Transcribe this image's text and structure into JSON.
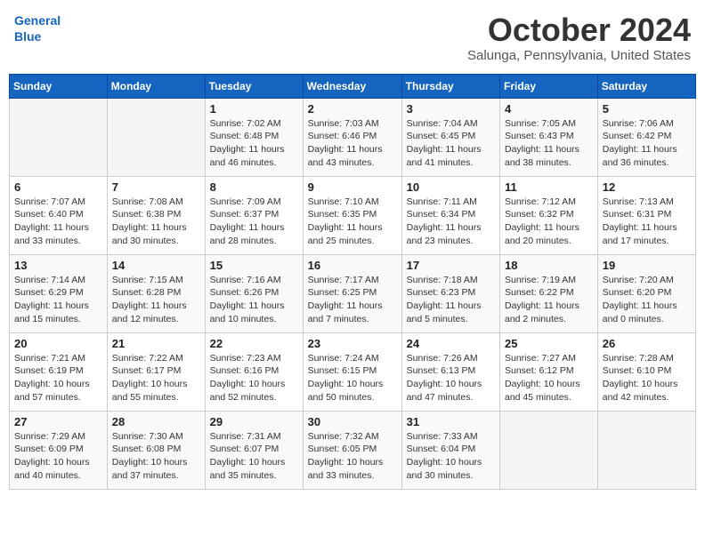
{
  "header": {
    "logo_line1": "General",
    "logo_line2": "Blue",
    "month": "October 2024",
    "location": "Salunga, Pennsylvania, United States"
  },
  "days_of_week": [
    "Sunday",
    "Monday",
    "Tuesday",
    "Wednesday",
    "Thursday",
    "Friday",
    "Saturday"
  ],
  "weeks": [
    [
      {
        "day": "",
        "info": ""
      },
      {
        "day": "",
        "info": ""
      },
      {
        "day": "1",
        "info": "Sunrise: 7:02 AM\nSunset: 6:48 PM\nDaylight: 11 hours and 46 minutes."
      },
      {
        "day": "2",
        "info": "Sunrise: 7:03 AM\nSunset: 6:46 PM\nDaylight: 11 hours and 43 minutes."
      },
      {
        "day": "3",
        "info": "Sunrise: 7:04 AM\nSunset: 6:45 PM\nDaylight: 11 hours and 41 minutes."
      },
      {
        "day": "4",
        "info": "Sunrise: 7:05 AM\nSunset: 6:43 PM\nDaylight: 11 hours and 38 minutes."
      },
      {
        "day": "5",
        "info": "Sunrise: 7:06 AM\nSunset: 6:42 PM\nDaylight: 11 hours and 36 minutes."
      }
    ],
    [
      {
        "day": "6",
        "info": "Sunrise: 7:07 AM\nSunset: 6:40 PM\nDaylight: 11 hours and 33 minutes."
      },
      {
        "day": "7",
        "info": "Sunrise: 7:08 AM\nSunset: 6:38 PM\nDaylight: 11 hours and 30 minutes."
      },
      {
        "day": "8",
        "info": "Sunrise: 7:09 AM\nSunset: 6:37 PM\nDaylight: 11 hours and 28 minutes."
      },
      {
        "day": "9",
        "info": "Sunrise: 7:10 AM\nSunset: 6:35 PM\nDaylight: 11 hours and 25 minutes."
      },
      {
        "day": "10",
        "info": "Sunrise: 7:11 AM\nSunset: 6:34 PM\nDaylight: 11 hours and 23 minutes."
      },
      {
        "day": "11",
        "info": "Sunrise: 7:12 AM\nSunset: 6:32 PM\nDaylight: 11 hours and 20 minutes."
      },
      {
        "day": "12",
        "info": "Sunrise: 7:13 AM\nSunset: 6:31 PM\nDaylight: 11 hours and 17 minutes."
      }
    ],
    [
      {
        "day": "13",
        "info": "Sunrise: 7:14 AM\nSunset: 6:29 PM\nDaylight: 11 hours and 15 minutes."
      },
      {
        "day": "14",
        "info": "Sunrise: 7:15 AM\nSunset: 6:28 PM\nDaylight: 11 hours and 12 minutes."
      },
      {
        "day": "15",
        "info": "Sunrise: 7:16 AM\nSunset: 6:26 PM\nDaylight: 11 hours and 10 minutes."
      },
      {
        "day": "16",
        "info": "Sunrise: 7:17 AM\nSunset: 6:25 PM\nDaylight: 11 hours and 7 minutes."
      },
      {
        "day": "17",
        "info": "Sunrise: 7:18 AM\nSunset: 6:23 PM\nDaylight: 11 hours and 5 minutes."
      },
      {
        "day": "18",
        "info": "Sunrise: 7:19 AM\nSunset: 6:22 PM\nDaylight: 11 hours and 2 minutes."
      },
      {
        "day": "19",
        "info": "Sunrise: 7:20 AM\nSunset: 6:20 PM\nDaylight: 11 hours and 0 minutes."
      }
    ],
    [
      {
        "day": "20",
        "info": "Sunrise: 7:21 AM\nSunset: 6:19 PM\nDaylight: 10 hours and 57 minutes."
      },
      {
        "day": "21",
        "info": "Sunrise: 7:22 AM\nSunset: 6:17 PM\nDaylight: 10 hours and 55 minutes."
      },
      {
        "day": "22",
        "info": "Sunrise: 7:23 AM\nSunset: 6:16 PM\nDaylight: 10 hours and 52 minutes."
      },
      {
        "day": "23",
        "info": "Sunrise: 7:24 AM\nSunset: 6:15 PM\nDaylight: 10 hours and 50 minutes."
      },
      {
        "day": "24",
        "info": "Sunrise: 7:26 AM\nSunset: 6:13 PM\nDaylight: 10 hours and 47 minutes."
      },
      {
        "day": "25",
        "info": "Sunrise: 7:27 AM\nSunset: 6:12 PM\nDaylight: 10 hours and 45 minutes."
      },
      {
        "day": "26",
        "info": "Sunrise: 7:28 AM\nSunset: 6:10 PM\nDaylight: 10 hours and 42 minutes."
      }
    ],
    [
      {
        "day": "27",
        "info": "Sunrise: 7:29 AM\nSunset: 6:09 PM\nDaylight: 10 hours and 40 minutes."
      },
      {
        "day": "28",
        "info": "Sunrise: 7:30 AM\nSunset: 6:08 PM\nDaylight: 10 hours and 37 minutes."
      },
      {
        "day": "29",
        "info": "Sunrise: 7:31 AM\nSunset: 6:07 PM\nDaylight: 10 hours and 35 minutes."
      },
      {
        "day": "30",
        "info": "Sunrise: 7:32 AM\nSunset: 6:05 PM\nDaylight: 10 hours and 33 minutes."
      },
      {
        "day": "31",
        "info": "Sunrise: 7:33 AM\nSunset: 6:04 PM\nDaylight: 10 hours and 30 minutes."
      },
      {
        "day": "",
        "info": ""
      },
      {
        "day": "",
        "info": ""
      }
    ]
  ]
}
